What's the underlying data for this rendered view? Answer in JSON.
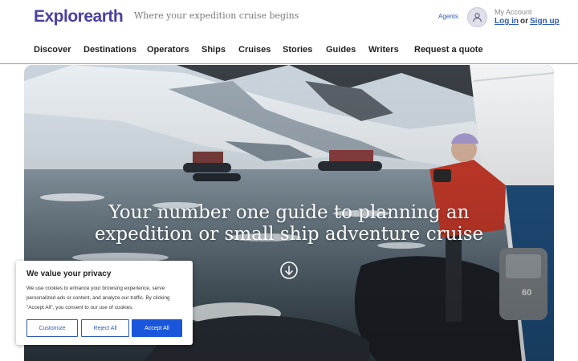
{
  "header": {
    "logo": "Explorearth",
    "tagline": "Where your expedition cruise begins",
    "agents_link": "Agents",
    "account_label": "My Account",
    "login_link": "Log in",
    "or_text": "or",
    "signup_link": "Sign up"
  },
  "nav": {
    "items": [
      "Discover",
      "Destinations",
      "Operators",
      "Ships",
      "Cruises",
      "Stories",
      "Guides",
      "Writers",
      "Request a quote"
    ]
  },
  "hero": {
    "headline_line1": "Your number one guide to planning an",
    "headline_line2": "expedition or small ship adventure cruise",
    "scroll_icon": "arrow-down-circle-icon",
    "motor_label": "60"
  },
  "cookie_banner": {
    "title": "We value your privacy",
    "body": "We use cookies to enhance your browsing experience, serve personalized ads or content, and analyze our traffic. By clicking \"Accept All\", you consent to our use of cookies.",
    "customize_label": "Customize",
    "reject_label": "Reject All",
    "accept_label": "Accept All"
  },
  "colors": {
    "brand": "#4a3fa3",
    "link": "#2f5bb3",
    "accept_button": "#1a56db"
  }
}
